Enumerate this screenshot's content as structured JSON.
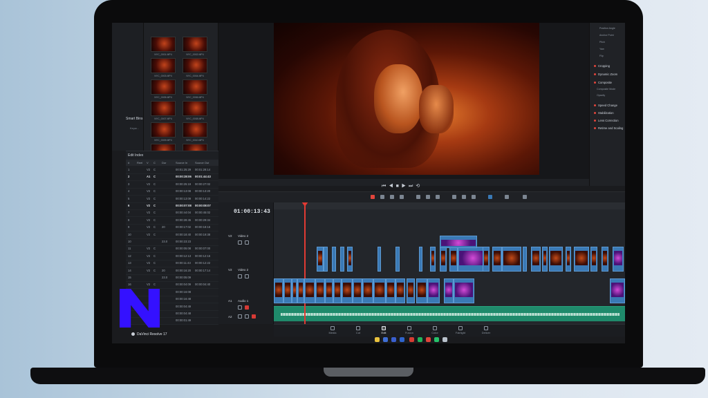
{
  "app": {
    "name": "DaVinci Resolve 17"
  },
  "timeline": {
    "timecode": "01:00:13:43"
  },
  "media_pool": {
    "smart_bins_label": "Smart Bins",
    "smart_bins_sub": "Keyw...",
    "clips": [
      "NYC_0001.MP4",
      "NYC_0002.MP4",
      "NYC_0003.MP4",
      "NYC_0004.MP4",
      "NYC_0005.MP4",
      "NYC_0006.MP4",
      "NYC_0007.MP4",
      "NYC_0008.MP4",
      "NYC_0009.MP4",
      "NYC_0010.MP4",
      "NYC_0011.MP4",
      "NYC_0012.MP4"
    ]
  },
  "edit_index": {
    "title": "Edit Index",
    "columns": [
      "#",
      "Reel",
      "V",
      "C",
      "Dur",
      "Source In",
      "Source Out"
    ],
    "rows": [
      {
        "n": "1",
        "v": "V2",
        "c": "C",
        "dur": "",
        "in": "00:01:25:29",
        "out": "00:01:28:14",
        "bold": false
      },
      {
        "n": "2",
        "v": "A1",
        "c": "C",
        "dur": "",
        "in": "00:00:28:06",
        "out": "00:01:44:43",
        "bold": true
      },
      {
        "n": "3",
        "v": "V2",
        "c": "C",
        "dur": "",
        "in": "00:00:25:19",
        "out": "00:00:27:02",
        "bold": false
      },
      {
        "n": "4",
        "v": "V2",
        "c": "C",
        "dur": "",
        "in": "00:00:13:08",
        "out": "00:00:13:20",
        "bold": false
      },
      {
        "n": "5",
        "v": "V2",
        "c": "C",
        "dur": "",
        "in": "00:00:13:09",
        "out": "00:00:14:22",
        "bold": false
      },
      {
        "n": "6",
        "v": "V2",
        "c": "C",
        "dur": "",
        "in": "00:00:07:08",
        "out": "00:00:08:07",
        "bold": true
      },
      {
        "n": "7",
        "v": "V2",
        "c": "C",
        "dur": "",
        "in": "00:00:44:04",
        "out": "00:00:45:02",
        "bold": false
      },
      {
        "n": "8",
        "v": "V2",
        "c": "C",
        "dur": "",
        "in": "00:00:28:45",
        "out": "00:00:29:34",
        "bold": false
      },
      {
        "n": "9",
        "v": "V2",
        "c": "C",
        "dur": "20",
        "in": "00:00:17:02",
        "out": "00:00:18:16",
        "bold": false
      },
      {
        "n": "10",
        "v": "V2",
        "c": "C",
        "dur": "",
        "in": "00:00:18:40",
        "out": "00:00:19:38",
        "bold": false
      },
      {
        "n": "10",
        "v": "",
        "c": "",
        "dur": "23.0",
        "in": "00:00:23:23",
        "out": "",
        "bold": false
      },
      {
        "n": "11",
        "v": "V2",
        "c": "C",
        "dur": "",
        "in": "00:00:05:08",
        "out": "00:00:07:00",
        "bold": false
      },
      {
        "n": "12",
        "v": "V2",
        "c": "C",
        "dur": "",
        "in": "00:00:12:13",
        "out": "00:00:12:16",
        "bold": false
      },
      {
        "n": "13",
        "v": "V2",
        "c": "C",
        "dur": "",
        "in": "00:00:11:43",
        "out": "00:00:12:22",
        "bold": false
      },
      {
        "n": "14",
        "v": "V2",
        "c": "C",
        "dur": "20",
        "in": "00:00:16:20",
        "out": "00:00:17:14",
        "bold": false
      },
      {
        "n": "15",
        "v": "",
        "c": "",
        "dur": "23.0",
        "in": "00:00:05:09",
        "out": "",
        "bold": false
      },
      {
        "n": "16",
        "v": "V2",
        "c": "C",
        "dur": "",
        "in": "00:00:04:09",
        "out": "00:00:04:40",
        "bold": false
      },
      {
        "n": "",
        "v": "",
        "c": "",
        "dur": "",
        "in": "00:00:16:08",
        "out": "",
        "bold": false
      },
      {
        "n": "",
        "v": "",
        "c": "",
        "dur": "",
        "in": "00:00:16:48",
        "out": "",
        "bold": false
      },
      {
        "n": "",
        "v": "",
        "c": "",
        "dur": "",
        "in": "00:00:04:49",
        "out": "",
        "bold": false
      },
      {
        "n": "",
        "v": "",
        "c": "",
        "dur": "",
        "in": "00:00:04:48",
        "out": "",
        "bold": false
      },
      {
        "n": "",
        "v": "",
        "c": "",
        "dur": "",
        "in": "00:00:01:49",
        "out": "",
        "bold": false
      }
    ]
  },
  "inspector": {
    "top_labels": [
      "Position Angle",
      "Anchor Point",
      "Pitch",
      "Yaw",
      "Flip"
    ],
    "sections": [
      {
        "label": "Cropping"
      },
      {
        "label": "Dynamic Zoom"
      },
      {
        "label": "Composite"
      },
      {
        "label": "Speed Change"
      },
      {
        "label": "Stabilization"
      },
      {
        "label": "Lens Correction"
      },
      {
        "label": "Retime and Scaling"
      }
    ],
    "composite_sub": [
      "Composite Mode",
      "Opacity"
    ]
  },
  "tracks": {
    "v2": {
      "id": "V2",
      "name": "Video 2"
    },
    "v1": {
      "id": "V2",
      "name": "Video 2"
    },
    "a1": {
      "id": "A1",
      "name": "Audio 1"
    },
    "a2": {
      "id": "A2",
      "name": ""
    }
  },
  "page_tabs": [
    {
      "label": "Media",
      "icon": "media-icon",
      "active": false
    },
    {
      "label": "Cut",
      "icon": "cut-icon",
      "active": false
    },
    {
      "label": "Edit",
      "icon": "edit-icon",
      "active": true
    },
    {
      "label": "Fusion",
      "icon": "fusion-icon",
      "active": false
    },
    {
      "label": "Color",
      "icon": "color-icon",
      "active": false
    },
    {
      "label": "Fairlight",
      "icon": "fairlight-icon",
      "active": false
    },
    {
      "label": "Deliver",
      "icon": "deliver-icon",
      "active": false
    }
  ],
  "colors": {
    "accent_red": "#e23a33",
    "clip_blue": "#3a79b5",
    "audio_green": "#1f8a6b",
    "logo_blue": "#3411ff"
  }
}
